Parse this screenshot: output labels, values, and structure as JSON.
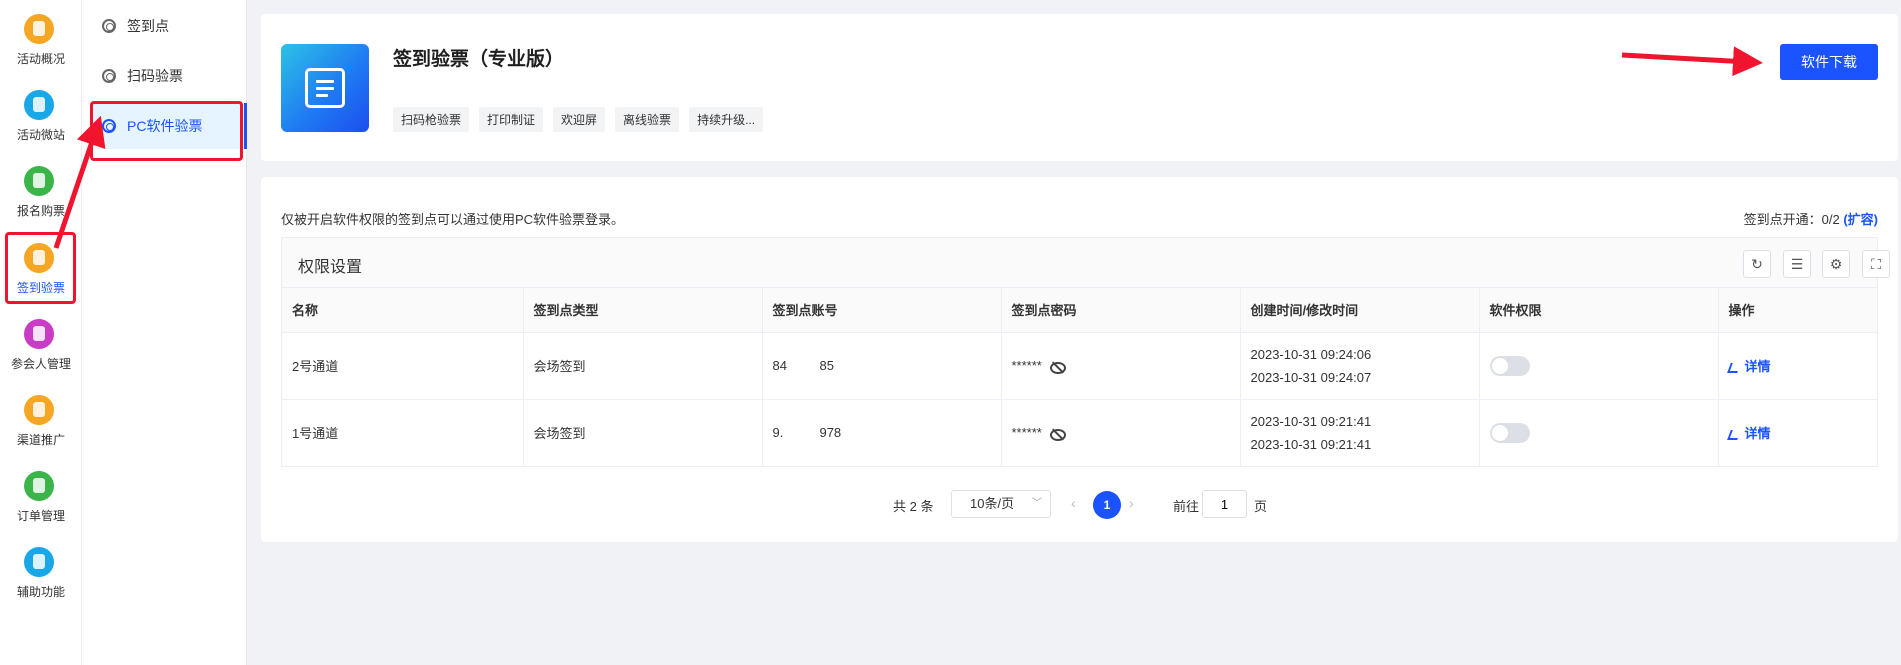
{
  "nav": {
    "items": [
      {
        "label": "活动概况",
        "color": "#f5a623"
      },
      {
        "label": "活动微站",
        "color": "#19a7e8"
      },
      {
        "label": "报名购票",
        "color": "#3bb54a"
      },
      {
        "label": "签到验票",
        "color": "#f5a623"
      },
      {
        "label": "参会人管理",
        "color": "#c93cc6"
      },
      {
        "label": "渠道推广",
        "color": "#f5a623"
      },
      {
        "label": "订单管理",
        "color": "#3bb54a"
      },
      {
        "label": "辅助功能",
        "color": "#19a7e8"
      }
    ]
  },
  "subnav": {
    "items": [
      {
        "label": "签到点"
      },
      {
        "label": "扫码验票"
      },
      {
        "label": "PC软件验票"
      }
    ]
  },
  "product": {
    "title": "签到验票（专业版）",
    "tags": [
      "扫码枪验票",
      "打印制证",
      "欢迎屏",
      "离线验票",
      "持续升级..."
    ],
    "download_label": "软件下载"
  },
  "main": {
    "notice": "仅被开启软件权限的签到点可以通过使用PC软件验票登录。",
    "quota_label": "签到点开通：0/2",
    "expand_label": "(扩容)",
    "table_title": "权限设置",
    "columns": [
      "名称",
      "签到点类型",
      "签到点账号",
      "签到点密码",
      "创建时间/修改时间",
      "软件权限",
      "操作"
    ],
    "rows": [
      {
        "name": "2号通道",
        "type": "会场签到",
        "account": "84         85",
        "password": "******",
        "created": "2023-10-31 09:24:06",
        "modified": "2023-10-31 09:24:07",
        "permission": false,
        "action": "详情"
      },
      {
        "name": "1号通道",
        "type": "会场签到",
        "account": "9.          978",
        "password": "******",
        "created": "2023-10-31 09:21:41",
        "modified": "2023-10-31 09:21:41",
        "permission": false,
        "action": "详情"
      }
    ]
  },
  "pagination": {
    "total_label": "共 2 条",
    "page_size": "10条/页",
    "current_page": "1",
    "goto_label": "前往",
    "goto_value": "1",
    "page_suffix": "页"
  },
  "colors": {
    "accent": "#1a53ff",
    "annotation": "#f0142f"
  }
}
